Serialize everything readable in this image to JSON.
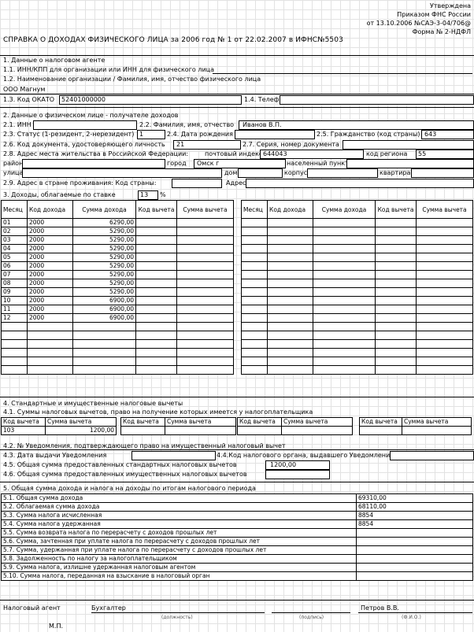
{
  "approval": {
    "line1": "Утверждена",
    "line2": "Приказом ФНС России",
    "line3": "от 13.10.2006 №САЭ-3-04/706@",
    "line4": "Форма № 2-НДФЛ"
  },
  "title": "СПРАВКА О ДОХОДАХ ФИЗИЧЕСКОГО ЛИЦА за 2006 год № 1 от 22.02.2007 в ИФНС№5503",
  "s1": {
    "heading": "1. Данные о налоговом агенте",
    "f11": "1.1. ИНН/КПП для организации или ИНН для физического лица",
    "f12": "1.2. Наименование организации / Фамилия, имя, отчество физического лица",
    "org_name": "ООО Магнум",
    "f13": "1.3. Код ОКАТО",
    "okato": "52401000000",
    "f14": "1.4. Телефон"
  },
  "s2": {
    "heading": "2. Данные о физическом лице - получателе доходов",
    "f21": "2.1. ИНН",
    "f22": "2.2. Фамилия, имя, отчество",
    "fio": "Иванов В.П.",
    "f23": "2.3. Статус (1-резидент, 2-нерезидент)",
    "status": "1",
    "f24": "2.4. Дата рождения",
    "f25": "2.5. Гражданство (код страны)",
    "citizenship": "643",
    "f26": "2.6. Код документа, удостоверяющего личность",
    "doc_code": "21",
    "f27": "2.7. Серия, номер документа",
    "f28": "2.8. Адрес места жительства в Российской Федерации:",
    "postcode_label": "почтовый индекс",
    "postcode": "644043",
    "region_label": "код региона",
    "region": "55",
    "district_label": "район",
    "city_label": "город",
    "city": "Омск г",
    "locality_label": "населенный пункт",
    "street_label": "улица",
    "house_label": "дом",
    "building_label": "корпус",
    "flat_label": "квартира",
    "f29": "2.9. Адрес в стране проживания: Код страны:",
    "address_label": "Адрес"
  },
  "s3": {
    "heading": "3. Доходы, облагаемые по ставке",
    "rate": "13",
    "pct": "%",
    "cols": [
      "Месяц",
      "Код дохода",
      "Сумма дохода",
      "Код вычета",
      "Сумма вычета"
    ],
    "rows": [
      [
        "01",
        "2000",
        "6290,00"
      ],
      [
        "02",
        "2000",
        "5290,00"
      ],
      [
        "03",
        "2000",
        "5290,00"
      ],
      [
        "04",
        "2000",
        "5290,00"
      ],
      [
        "05",
        "2000",
        "5290,00"
      ],
      [
        "06",
        "2000",
        "5290,00"
      ],
      [
        "07",
        "2000",
        "5290,00"
      ],
      [
        "08",
        "2000",
        "5290,00"
      ],
      [
        "09",
        "2000",
        "5290,00"
      ],
      [
        "10",
        "2000",
        "6900,00"
      ],
      [
        "11",
        "2000",
        "6900,00"
      ],
      [
        "12",
        "2000",
        "6900,00"
      ]
    ]
  },
  "s4": {
    "heading": "4. Стандартные и имущественные налоговые вычеты",
    "f41": "4.1. Суммы налоговых вычетов, право на получение которых имеется у налогоплательщика",
    "code_label": "Код вычета",
    "sum_label": "Сумма вычета",
    "code_val": "103",
    "sum_val": "1200,00",
    "f42": "4.2. № Уведомления, подтверждающего право на имущественный налоговый вычет",
    "f43": "4.3. Дата выдачи Уведомления",
    "f44": "4.4.Код налогового органа, выдавшего Уведомление",
    "f45": "4.5. Общая сумма предоставленных стандартных налоговых вычетов",
    "f45_val": "1200,00",
    "f46": "4.6. Общая сумма предоставленных имущественных налоговых вычетов"
  },
  "s5": {
    "heading": "5. Общая сумма дохода и налога на доходы по итогам налогового периода",
    "rows": [
      {
        "label": "5.1. Общая сумма дохода",
        "value": "69310,00"
      },
      {
        "label": "5.2. Облагаемая сумма дохода",
        "value": "68110,00"
      },
      {
        "label": "5.3. Сумма налога исчисленная",
        "value": "8854"
      },
      {
        "label": "5.4. Сумма налога удержанная",
        "value": "8854"
      },
      {
        "label": "5.5. Сумма возврата налога по перерасчету с доходов прошлых лет",
        "value": ""
      },
      {
        "label": "5.6. Сумма, зачтенная при уплате налога по перерасчету с доходов прошлых лет",
        "value": ""
      },
      {
        "label": "5.7. Сумма, удержанная при уплате налога по перерасчету с доходов прошлых лет",
        "value": ""
      },
      {
        "label": "5.8. Задолженность по налогу за налогоплательщиком",
        "value": ""
      },
      {
        "label": "5.9. Сумма налога, излишне удержанная налоговым агентом",
        "value": ""
      },
      {
        "label": "5.10. Сумма налога, переданная на взыскание в налоговый орган",
        "value": ""
      }
    ]
  },
  "footer": {
    "agent": "Налоговый агент",
    "accountant": "Бухгалтер",
    "signer": "Петров В.В.",
    "hint1": "(должность)",
    "hint2": "(подпись)",
    "hint3": "(Ф.И.О.)",
    "mp": "М.П."
  }
}
